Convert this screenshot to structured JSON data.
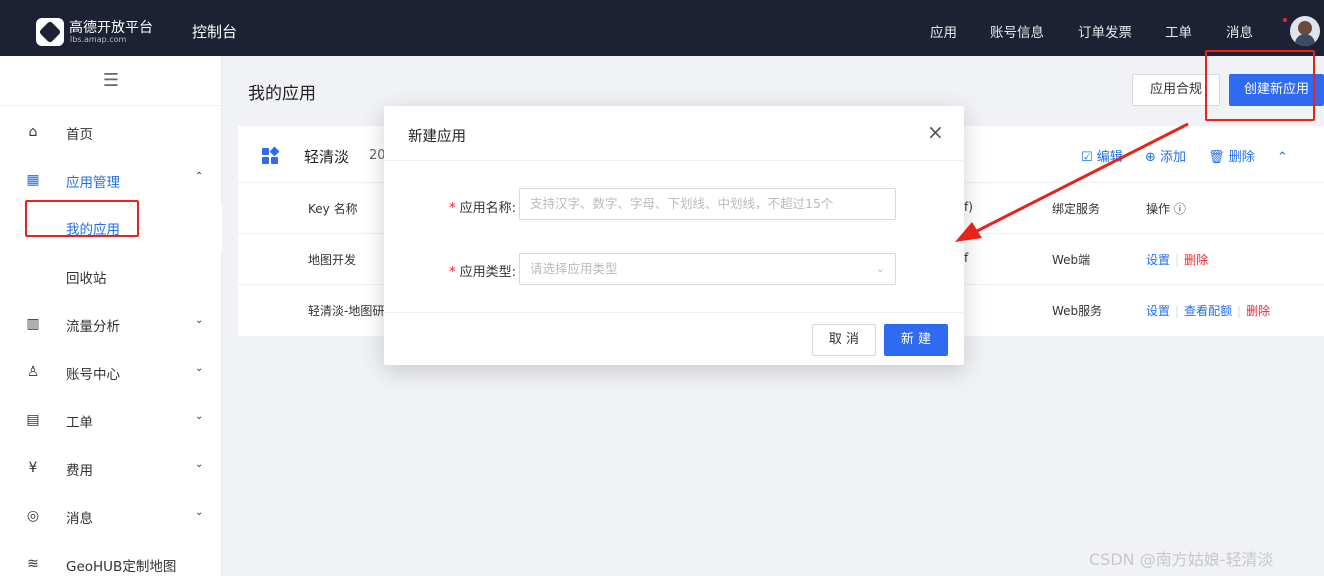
{
  "topnav": {
    "logo_title": "高德开放平台",
    "logo_sub": "lbs.amap.com",
    "console": "控制台",
    "items": [
      "应用",
      "账号信息",
      "订单发票",
      "工单",
      "消息"
    ]
  },
  "sidebar": {
    "toggle": "☰",
    "items": [
      {
        "label": "首页",
        "icon": "⌂",
        "arrow": ""
      },
      {
        "label": "应用管理",
        "icon": "▦",
        "arrow": "⌃"
      },
      {
        "label": "我的应用",
        "icon": "",
        "arrow": ""
      },
      {
        "label": "回收站",
        "icon": "",
        "arrow": ""
      },
      {
        "label": "流量分析",
        "icon": "▥",
        "arrow": "⌄"
      },
      {
        "label": "账号中心",
        "icon": "♙",
        "arrow": "⌄"
      },
      {
        "label": "工单",
        "icon": "▤",
        "arrow": "⌄"
      },
      {
        "label": "费用",
        "icon": "¥",
        "arrow": "⌄"
      },
      {
        "label": "消息",
        "icon": "◎",
        "arrow": "⌄"
      },
      {
        "label": "GeoHUB定制地图",
        "icon": "≋",
        "arrow": ""
      }
    ]
  },
  "main": {
    "page_title": "我的应用",
    "btn_compliance": "应用合规",
    "btn_create": "创建新应用",
    "card": {
      "name": "轻清淡",
      "date": "20",
      "actions": [
        "☑ 编辑",
        "⊕ 添加",
        "🗑 删除",
        "⌃"
      ],
      "headers": {
        "key_name": "Key 名称",
        "partial": "f)",
        "service": "绑定服务",
        "ops": "操作 ⓘ"
      },
      "rows": [
        {
          "name": "地图开发",
          "partial": "f",
          "service": "Web端",
          "ops": [
            "设置",
            "删除"
          ]
        },
        {
          "name": "轻清淡-地图研",
          "partial": "",
          "service": "Web服务",
          "ops": [
            "设置",
            "查看配额",
            "删除"
          ]
        }
      ]
    }
  },
  "modal": {
    "title": "新建应用",
    "close": "×",
    "fields": [
      {
        "label": "应用名称:",
        "placeholder": "支持汉字、数字、字母、下划线、中划线，不超过15个"
      },
      {
        "label": "应用类型:",
        "placeholder": "请选择应用类型",
        "arrow": "⌄"
      }
    ],
    "required_mark": "*",
    "cancel": "取 消",
    "submit": "新 建"
  },
  "watermark": "CSDN @南方姑娘-轻清淡",
  "colors": {
    "nav_bg": "#1c2233",
    "primary": "#2f6bf0",
    "annotation": "#e8231c"
  }
}
